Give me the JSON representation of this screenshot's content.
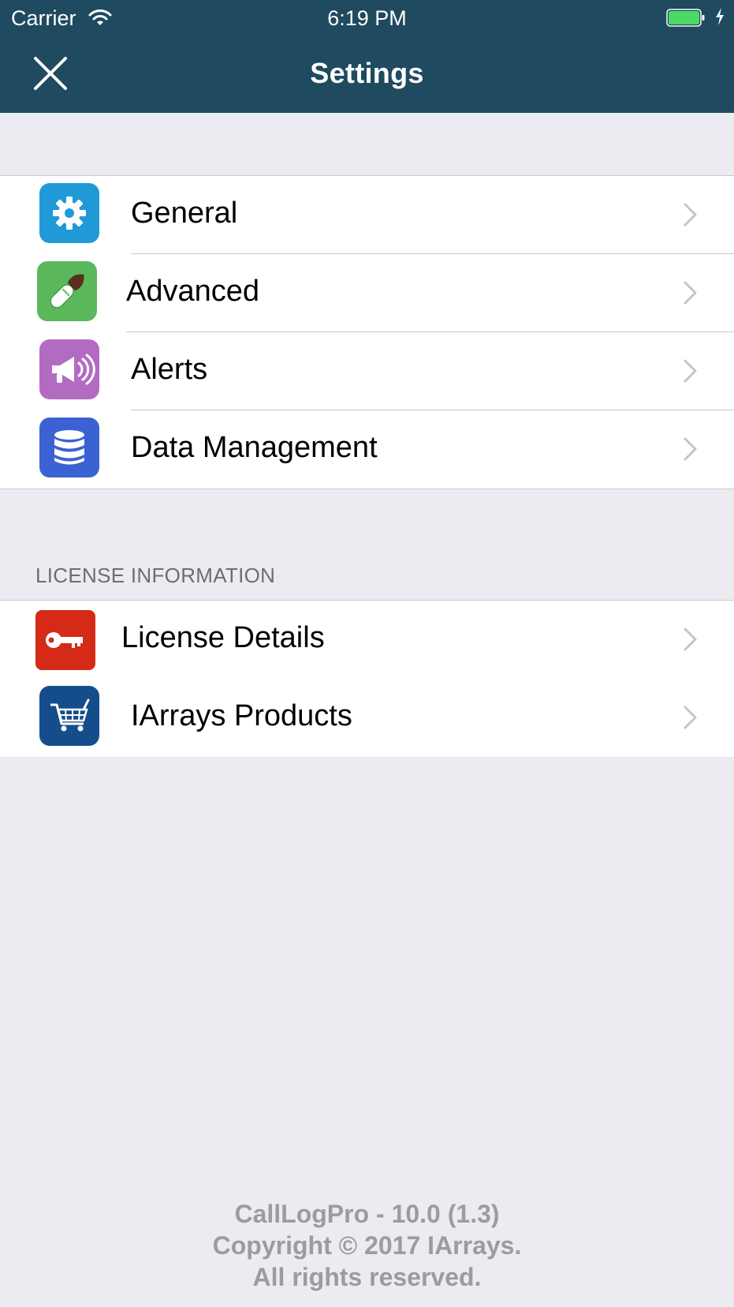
{
  "status_bar": {
    "carrier": "Carrier",
    "time": "6:19 PM"
  },
  "nav": {
    "title": "Settings",
    "close_icon": "close-icon"
  },
  "settings_group": {
    "items": [
      {
        "label": "General",
        "icon": "gear-icon",
        "color": "#1f9ad6"
      },
      {
        "label": "Advanced",
        "icon": "paintbrush-icon",
        "color": "#5ab85a"
      },
      {
        "label": "Alerts",
        "icon": "megaphone-icon",
        "color": "#b36bc2"
      },
      {
        "label": "Data Management",
        "icon": "database-icon",
        "color": "#3b62d3"
      }
    ]
  },
  "license_group": {
    "header": "LICENSE INFORMATION",
    "items": [
      {
        "label": "License Details",
        "icon": "key-icon",
        "color": "#d42a17"
      },
      {
        "label": "IArrays Products",
        "icon": "shopping-cart-icon",
        "color": "#154d8c"
      }
    ]
  },
  "footer": {
    "line1": "CallLogPro - 10.0 (1.3)",
    "line2": "Copyright © 2017 IArrays.",
    "line3": "All rights reserved."
  }
}
